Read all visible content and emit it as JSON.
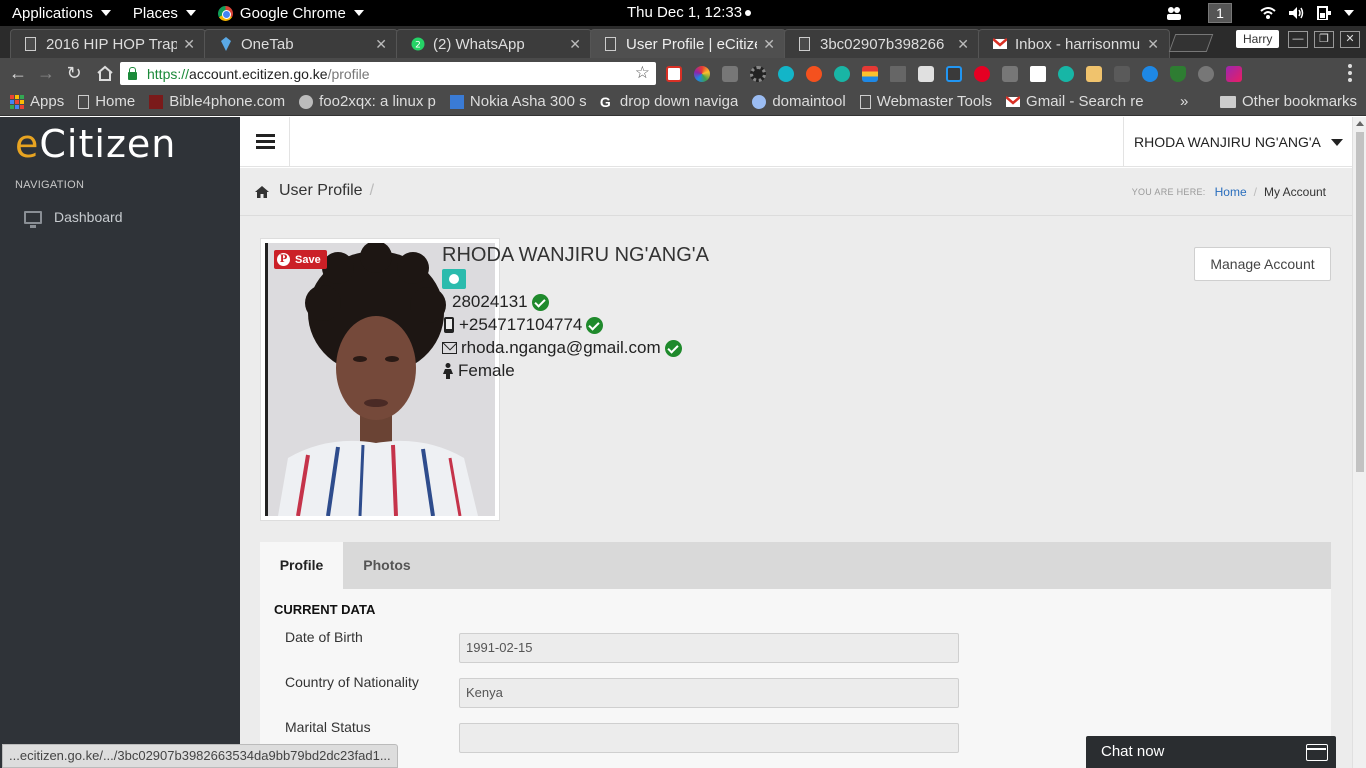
{
  "topbar": {
    "applications": "Applications",
    "places": "Places",
    "browser": "Google Chrome",
    "clock": "Thu Dec  1, 12:33",
    "workspace": "1"
  },
  "tabs": [
    {
      "title": "2016 HIP HOP Trap",
      "favicon": "page-icon"
    },
    {
      "title": "OneTab",
      "favicon": "onetab-icon"
    },
    {
      "title": "(2) WhatsApp",
      "favicon": "whatsapp-icon"
    },
    {
      "title": "User Profile | eCitize",
      "favicon": "page-icon",
      "active": true
    },
    {
      "title": "3bc02907b398266",
      "favicon": "page-icon"
    },
    {
      "title": "Inbox - harrisonmule",
      "favicon": "gmail-icon"
    }
  ],
  "window": {
    "user": "Harry"
  },
  "omnibox": {
    "scheme": "https://",
    "host": "account.ecitizen.go.ke",
    "path": "/profile"
  },
  "bookmarks": [
    {
      "label": "Apps"
    },
    {
      "label": "Home"
    },
    {
      "label": "Bible4phone.com"
    },
    {
      "label": "foo2xqx: a linux p"
    },
    {
      "label": "Nokia Asha 300 s"
    },
    {
      "label": "drop down naviga"
    },
    {
      "label": "domaintool"
    },
    {
      "label": "Webmaster Tools"
    },
    {
      "label": "Gmail - Search re"
    }
  ],
  "bookmarks_more": "»",
  "other_bookmarks": "Other bookmarks",
  "sidebar": {
    "logo_e": "e",
    "logo_rest": "Citizen",
    "nav_heading": "NAVIGATION",
    "dashboard": "Dashboard"
  },
  "header": {
    "user_name": "RHODA WANJIRU NG'ANG'A"
  },
  "breadcrumb": {
    "title": "User Profile",
    "separator": "/",
    "you_are_here": "YOU ARE HERE:",
    "home": "Home",
    "current": "My Account"
  },
  "profile": {
    "pin_save": "Save",
    "name": "RHODA WANJIRU NG'ANG'A",
    "id_number": "28024131",
    "phone": "+254717104774",
    "email": "rhoda.nganga@gmail.com",
    "gender": "Female",
    "manage_account": "Manage Account"
  },
  "profile_tabs": [
    {
      "label": "Profile",
      "active": true
    },
    {
      "label": "Photos",
      "active": false
    }
  ],
  "current_data": {
    "heading": "CURRENT DATA",
    "fields": [
      {
        "label": "Date of Birth",
        "value": "1991-02-15"
      },
      {
        "label": "Country of Nationality",
        "value": "Kenya"
      },
      {
        "label": "Marital Status",
        "value": ""
      }
    ]
  },
  "chat": {
    "label": "Chat now"
  },
  "status_url": "...ecitizen.go.ke/.../3bc02907b3982663534da9bb79bd2dc23fad1...",
  "colors": {
    "sidebar_bg": "#2f3338",
    "logo_accent": "#e8a421",
    "content_bg": "#ececec",
    "verified_green": "#1f8a2c",
    "link_blue": "#2a6ebd",
    "pinterest_red": "#cb2027"
  }
}
